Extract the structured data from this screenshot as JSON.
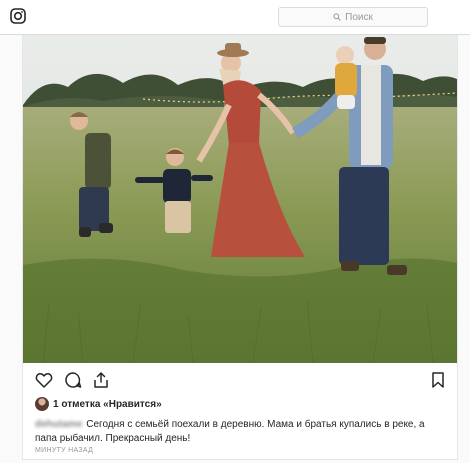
{
  "search": {
    "placeholder": "Поиск"
  },
  "post": {
    "likes_text": "1 отметка «Нравится»",
    "username": "dehutame",
    "caption": "Сегодня с семьёй поехали в деревню. Мама и братья купались в реке, а папа рыбачил. Прекрасный день!",
    "timestamp": "МИНУТУ НАЗАД"
  },
  "icons": {
    "app": "instagram-icon",
    "search": "search-icon",
    "like": "heart-icon",
    "comment": "comment-icon",
    "share": "share-icon",
    "save": "bookmark-icon"
  },
  "colors": {
    "text": "#262626",
    "secondary": "#999999",
    "border": "#dbdbdb",
    "background": "#fafafa"
  }
}
